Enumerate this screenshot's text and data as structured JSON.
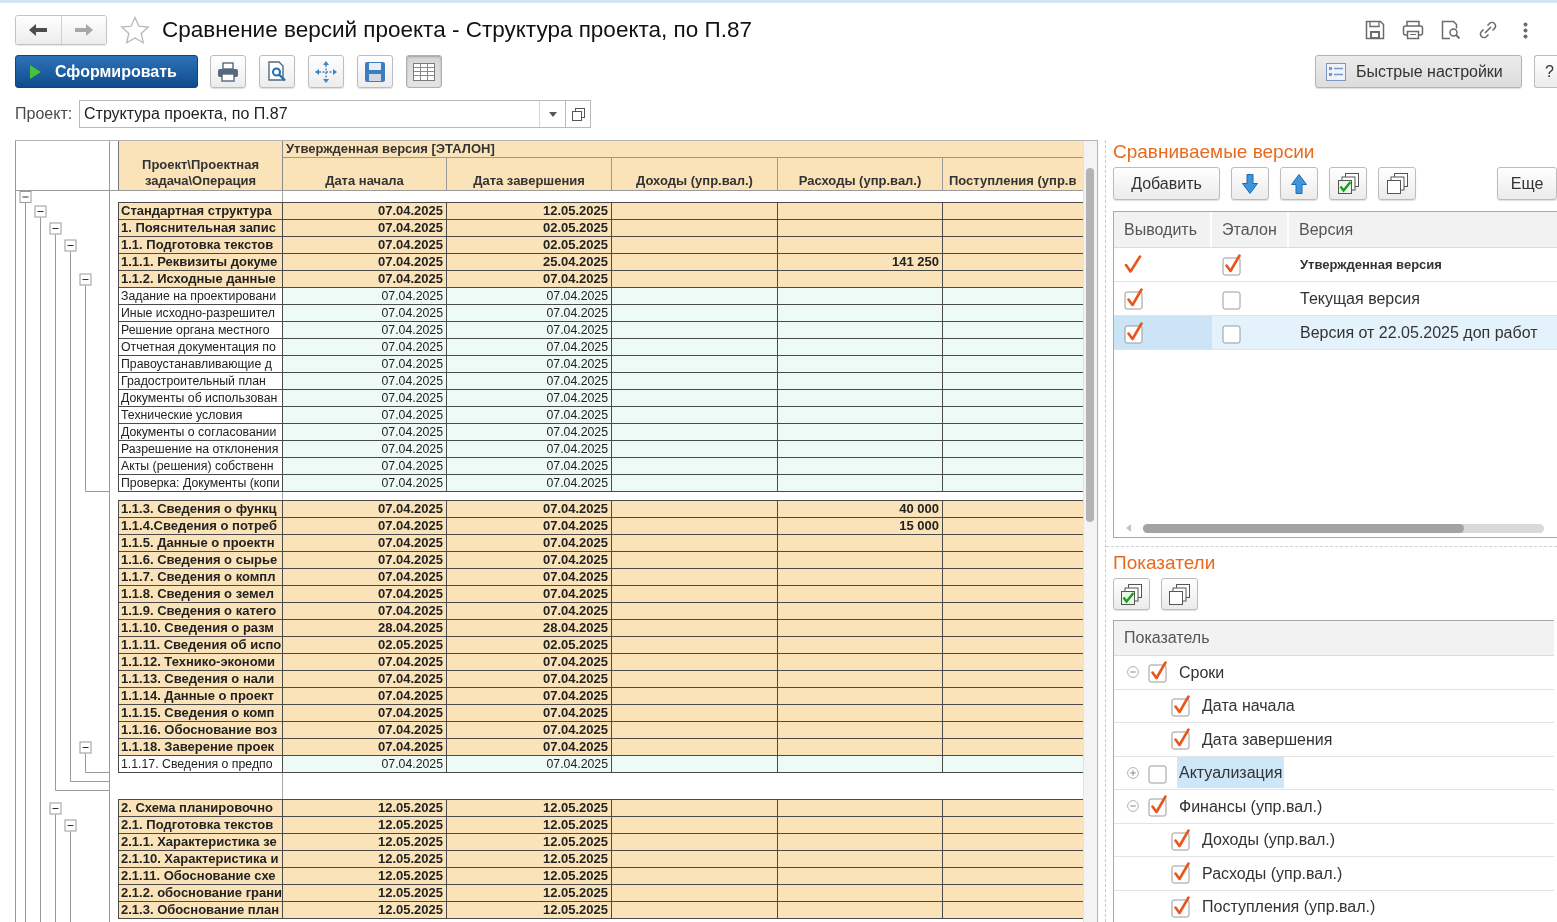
{
  "window": {
    "title": "Сравнение версий проекта - Структура проекта, по П.87",
    "favorite": false,
    "nav_back": {
      "disabled": false
    },
    "nav_forward": {
      "disabled": true
    }
  },
  "toolbar": {
    "report_button": "Сформировать",
    "icon_buttons": [
      {
        "kind": "print",
        "pressed": false
      },
      {
        "kind": "preview",
        "pressed": false
      },
      {
        "kind": "arrows",
        "pressed": false
      },
      {
        "kind": "save",
        "pressed": false
      },
      {
        "kind": "grid",
        "pressed": true
      }
    ],
    "quick_settings_button": "Быстрые настройки",
    "help_button": "?"
  },
  "project_field": {
    "label": "Проект:",
    "value": "Структура проекта, по П.87"
  },
  "report": {
    "version_heading": "Утвержденная версия [ЭТАЛОН]",
    "columns": [
      "Проект\\Проектная задача\\Операция",
      "Дата начала",
      "Дата завершения",
      "Доходы (упр.вал.)",
      "Расходы (упр.вал.)",
      "Поступления (упр.в"
    ],
    "outline": {
      "expanded": true,
      "rows": [
        {
          "name": "Стандартная структура",
          "kind": "task",
          "start": "07.04.2025",
          "end": "12.05.2025",
          "expanded": true,
          "children": [
            {
              "name": "1. Пояснительная запис",
              "kind": "task",
              "start": "07.04.2025",
              "end": "02.05.2025",
              "expanded": true,
              "children": [
                {
                  "name": "1.1. Подготовка текстов",
                  "kind": "task",
                  "start": "07.04.2025",
                  "end": "02.05.2025",
                  "expanded": true,
                  "children": [
                    {
                      "name": "1.1.1. Реквизиты докуме",
                      "kind": "task",
                      "start": "07.04.2025",
                      "end": "25.04.2025",
                      "expenses": "141 250"
                    },
                    {
                      "name": "1.1.2. Исходные данные",
                      "kind": "task",
                      "start": "07.04.2025",
                      "end": "07.04.2025",
                      "expanded": true,
                      "children": [
                        {
                          "name": "Задание на проектировани",
                          "kind": "operation",
                          "start": "07.04.2025",
                          "end": "07.04.2025"
                        },
                        {
                          "name": "Иные исходно-разрешител",
                          "kind": "operation",
                          "start": "07.04.2025",
                          "end": "07.04.2025"
                        },
                        {
                          "name": "Решение органа местного",
                          "kind": "operation",
                          "start": "07.04.2025",
                          "end": "07.04.2025"
                        },
                        {
                          "name": "Отчетная документация по",
                          "kind": "operation",
                          "start": "07.04.2025",
                          "end": "07.04.2025"
                        },
                        {
                          "name": "Правоустанавливающие д",
                          "kind": "operation",
                          "start": "07.04.2025",
                          "end": "07.04.2025"
                        },
                        {
                          "name": "Градостроительный план",
                          "kind": "operation",
                          "start": "07.04.2025",
                          "end": "07.04.2025"
                        },
                        {
                          "name": "Документы об использован",
                          "kind": "operation",
                          "start": "07.04.2025",
                          "end": "07.04.2025"
                        },
                        {
                          "name": "Технические условия",
                          "kind": "operation",
                          "start": "07.04.2025",
                          "end": "07.04.2025"
                        },
                        {
                          "name": "Документы о согласовании",
                          "kind": "operation",
                          "start": "07.04.2025",
                          "end": "07.04.2025"
                        },
                        {
                          "name": "Разрешение на отклонения",
                          "kind": "operation",
                          "start": "07.04.2025",
                          "end": "07.04.2025"
                        },
                        {
                          "name": "Акты (решения) собственн",
                          "kind": "operation",
                          "start": "07.04.2025",
                          "end": "07.04.2025"
                        },
                        {
                          "name": "Проверка: Документы (копи",
                          "kind": "operation",
                          "start": "07.04.2025",
                          "end": "07.04.2025"
                        }
                      ]
                    },
                    {
                      "name": "1.1.3. Сведения о функц",
                      "kind": "task",
                      "start": "07.04.2025",
                      "end": "07.04.2025",
                      "expenses": "40 000"
                    },
                    {
                      "name": "1.1.4.Сведения о потреб",
                      "kind": "task",
                      "start": "07.04.2025",
                      "end": "07.04.2025",
                      "expenses": "15 000"
                    },
                    {
                      "name": "1.1.5. Данные о проектн",
                      "kind": "task",
                      "start": "07.04.2025",
                      "end": "07.04.2025"
                    },
                    {
                      "name": "1.1.6. Сведения о сырье",
                      "kind": "task",
                      "start": "07.04.2025",
                      "end": "07.04.2025"
                    },
                    {
                      "name": "1.1.7. Сведения о компл",
                      "kind": "task",
                      "start": "07.04.2025",
                      "end": "07.04.2025"
                    },
                    {
                      "name": "1.1.8. Сведения о земел",
                      "kind": "task",
                      "start": "07.04.2025",
                      "end": "07.04.2025"
                    },
                    {
                      "name": "1.1.9. Сведения о катего",
                      "kind": "task",
                      "start": "07.04.2025",
                      "end": "07.04.2025"
                    },
                    {
                      "name": "1.1.10. Сведения о разм",
                      "kind": "task",
                      "start": "28.04.2025",
                      "end": "28.04.2025"
                    },
                    {
                      "name": "1.1.11. Сведения об испо",
                      "kind": "task",
                      "start": "02.05.2025",
                      "end": "02.05.2025"
                    },
                    {
                      "name": "1.1.12. Технико-экономи",
                      "kind": "task",
                      "start": "07.04.2025",
                      "end": "07.04.2025"
                    },
                    {
                      "name": "1.1.13. Сведения о нали",
                      "kind": "task",
                      "start": "07.04.2025",
                      "end": "07.04.2025"
                    },
                    {
                      "name": "1.1.14. Данные о проект",
                      "kind": "task",
                      "start": "07.04.2025",
                      "end": "07.04.2025"
                    },
                    {
                      "name": "1.1.15. Сведения о комп",
                      "kind": "task",
                      "start": "07.04.2025",
                      "end": "07.04.2025"
                    },
                    {
                      "name": "1.1.16. Обоснование воз",
                      "kind": "task",
                      "start": "07.04.2025",
                      "end": "07.04.2025"
                    },
                    {
                      "name": "1.1.18. Заверение проек",
                      "kind": "task",
                      "start": "07.04.2025",
                      "end": "07.04.2025",
                      "expanded": true,
                      "children": [
                        {
                          "name": "1.1.17. Сведения о предпо",
                          "kind": "operation",
                          "start": "07.04.2025",
                          "end": "07.04.2025"
                        }
                      ]
                    }
                  ]
                }
              ]
            },
            {
              "name": "2. Схема планировочно",
              "kind": "task",
              "start": "12.05.2025",
              "end": "12.05.2025",
              "expanded": true,
              "children": [
                {
                  "name": "2.1. Подготовка текстов",
                  "kind": "task",
                  "start": "12.05.2025",
                  "end": "12.05.2025",
                  "expanded": true,
                  "children": [
                    {
                      "name": "2.1.1. Характеристика зе",
                      "kind": "task",
                      "start": "12.05.2025",
                      "end": "12.05.2025"
                    },
                    {
                      "name": "2.1.10. Характеристика и",
                      "kind": "task",
                      "start": "12.05.2025",
                      "end": "12.05.2025"
                    },
                    {
                      "name": "2.1.11. Обоснование схе",
                      "kind": "task",
                      "start": "12.05.2025",
                      "end": "12.05.2025"
                    },
                    {
                      "name": "2.1.2. обоснование грани",
                      "kind": "task",
                      "start": "12.05.2025",
                      "end": "12.05.2025"
                    },
                    {
                      "name": "2.1.3. Обоснование план",
                      "kind": "task",
                      "start": "12.05.2025",
                      "end": "12.05.2025"
                    }
                  ]
                }
              ]
            }
          ]
        }
      ]
    }
  },
  "versions": {
    "heading": "Сравниваемые версии",
    "add_button": "Добавить",
    "more_button": "Еще",
    "columns": [
      "Выводить",
      "Эталон",
      "Версия"
    ],
    "rows": [
      {
        "output": true,
        "output_readonly": true,
        "etalon": true,
        "name": "Утвержденная версия",
        "selected": false
      },
      {
        "output": true,
        "output_readonly": false,
        "etalon": false,
        "name": "Текущая версия",
        "selected": false
      },
      {
        "output": true,
        "output_readonly": false,
        "etalon": false,
        "name": "Версия от 22.05.2025 доп работ",
        "selected": true
      }
    ]
  },
  "indicators": {
    "heading": "Показатели",
    "column": "Показатель",
    "items": [
      {
        "name": "Сроки",
        "checked": true,
        "expanded": true,
        "selected": false,
        "children": [
          {
            "name": "Дата начала",
            "checked": true,
            "selected": false
          },
          {
            "name": "Дата завершения",
            "checked": true,
            "selected": false
          }
        ]
      },
      {
        "name": "Актуализация",
        "checked": false,
        "expanded": false,
        "selected": true
      },
      {
        "name": "Финансы (упр.вал.)",
        "checked": true,
        "expanded": true,
        "selected": false,
        "children": [
          {
            "name": "Доходы (упр.вал.)",
            "checked": true,
            "selected": false
          },
          {
            "name": "Расходы (упр.вал.)",
            "checked": true,
            "selected": false
          },
          {
            "name": "Поступления (упр.вал.)",
            "checked": true,
            "selected": false
          }
        ]
      }
    ]
  }
}
